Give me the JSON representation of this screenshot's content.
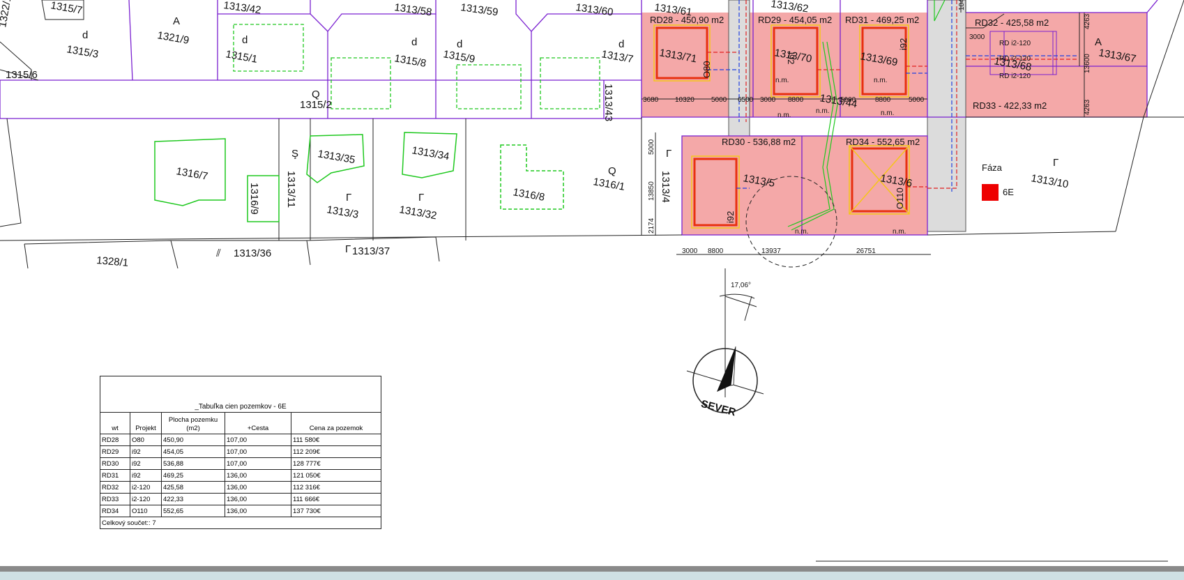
{
  "colors": {
    "parcel_line": "#7a20d0",
    "building_fill": "#f4a8a8",
    "house_outline": "#e83010",
    "green_dashed": "#1ec81e",
    "road_fill": "#dcdcdc"
  },
  "map": {
    "parcels": [
      "1322/1",
      "1315/7",
      "1315/6",
      "1315/3",
      "1321/9",
      "1313/42",
      "1315/1",
      "1313/58",
      "1313/59",
      "1313/60",
      "1315/8",
      "1315/9",
      "1313/7",
      "1313/61",
      "1313/62",
      "1315/2",
      "1313/43",
      "1316/7",
      "1316/9",
      "1313/11",
      "1313/35",
      "1313/3",
      "1313/34",
      "1313/32",
      "1316/8",
      "1316/1",
      "1313/4",
      "1313/71",
      "1313/70",
      "1313/69",
      "1313/68",
      "1313/67",
      "1313/44",
      "1313/5",
      "1313/6",
      "1313/10",
      "1313/36",
      "1313/37",
      "1328/1"
    ],
    "plots": [
      {
        "label": "RD28 -  450,90 m2",
        "code": "O80"
      },
      {
        "label": "RD29 -  454,05 m2",
        "code": "i92"
      },
      {
        "label": "RD31 -  469,25 m2",
        "code": "i92"
      },
      {
        "label": "RD32 -  425,58 m2",
        "code": ""
      },
      {
        "label": "RD33 -  422,33 m2",
        "code": ""
      },
      {
        "label": "RD30 -  536,88 m2",
        "code": "i92"
      },
      {
        "label": "RD34 -  552,65 m2",
        "code": "O110"
      }
    ],
    "rd_labels": [
      "RD i2-120",
      "RD i2-120",
      "RD i2-120"
    ],
    "nm": "n.m.",
    "dims_top": [
      "3680",
      "10320",
      "5000",
      "6500",
      "3000",
      "8800",
      "5000",
      "8800",
      "5000"
    ],
    "dims_bottom": [
      "3000",
      "8800",
      "13937",
      "26751"
    ],
    "dims_vertical": [
      "5000",
      "13850",
      "2174",
      "4263",
      "13600",
      "4263",
      "10493"
    ],
    "dim_3000": "3000",
    "phase_label": "Fáza",
    "phase_code": "6E",
    "angle": "17,06°",
    "north_label": "SEVER",
    "symbols": {
      "a": "A",
      "d": "d",
      "q": "Q",
      "r": "Γ",
      "s": "Ş",
      "hatch": "⫽"
    }
  },
  "table": {
    "title": "_Tabuľka cien pozemkov - 6E",
    "headers": [
      "wt",
      "Projekt",
      "Plocha pozemku (m2)",
      "+Cesta",
      "Cena za pozemok"
    ],
    "rows": [
      [
        "RD28",
        "O80",
        "450,90",
        "107,00",
        "111 580€"
      ],
      [
        "RD29",
        "i92",
        "454,05",
        "107,00",
        "112 209€"
      ],
      [
        "RD30",
        "i92",
        "536,88",
        "107,00",
        "128 777€"
      ],
      [
        "RD31",
        "i92",
        "469,25",
        "136,00",
        "121 050€"
      ],
      [
        "RD32",
        "i2-120",
        "425,58",
        "136,00",
        "112 316€"
      ],
      [
        "RD33",
        "i2-120",
        "422,33",
        "136,00",
        "111 666€"
      ],
      [
        "RD34",
        "O110",
        "552,65",
        "136,00",
        "137 730€"
      ]
    ],
    "footer": "Celkový součet:: 7"
  }
}
